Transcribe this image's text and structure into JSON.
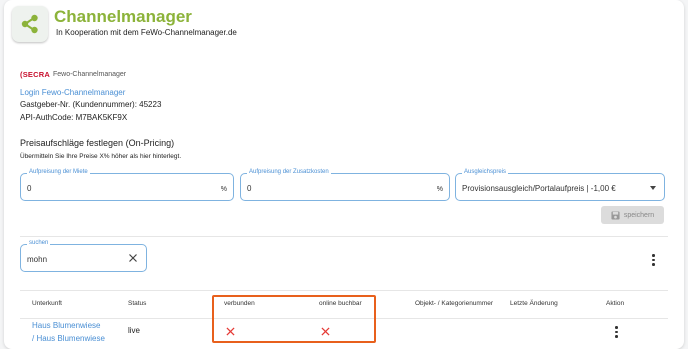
{
  "header": {
    "title": "Channelmanager",
    "subtitle": "In Kooperation mit dem FeWo-Channelmanager.de",
    "icon": "share-icon"
  },
  "brand": {
    "logo_text": "SECRA",
    "product": "Fewo-Channelmanager"
  },
  "account": {
    "login_link": "Login Fewo-Channelmanager",
    "host_number": "Gastgeber-Nr. (Kundennummer): 45223",
    "api_code": "API-AuthCode: M7BAK5KF9X"
  },
  "pricing": {
    "title": "Preisaufschläge festlegen (On-Pricing)",
    "subtitle": "Übermitteln Sie Ihre Preise X% höher als hier hinterlegt.",
    "rent_label": "Aufpreisung der Miete",
    "rent_value": "0",
    "rent_unit": "%",
    "extra_label": "Aufpreisung der Zusatzkosten",
    "extra_value": "0",
    "extra_unit": "%",
    "compensation_label": "Ausgleichspreis",
    "compensation_value": "Provisionsausgleich/Portalaufpreis | -1,00 €",
    "save_label": "speichern"
  },
  "search": {
    "label": "suchen",
    "value": "mohn"
  },
  "table": {
    "headers": [
      "Unterkunft",
      "Status",
      "verbunden",
      "online buchbar",
      "Objekt- / Kategorienummer",
      "Letzte Änderung",
      "Aktion"
    ],
    "rows": [
      {
        "name_line1": "Haus Blumenwiese",
        "name_line2": "/ Haus Blumenwiese",
        "status": "live"
      }
    ]
  },
  "colors": {
    "accent": "#8cb33a",
    "link": "#4a8fd4",
    "highlight": "#e8601c",
    "error": "#e53935"
  }
}
